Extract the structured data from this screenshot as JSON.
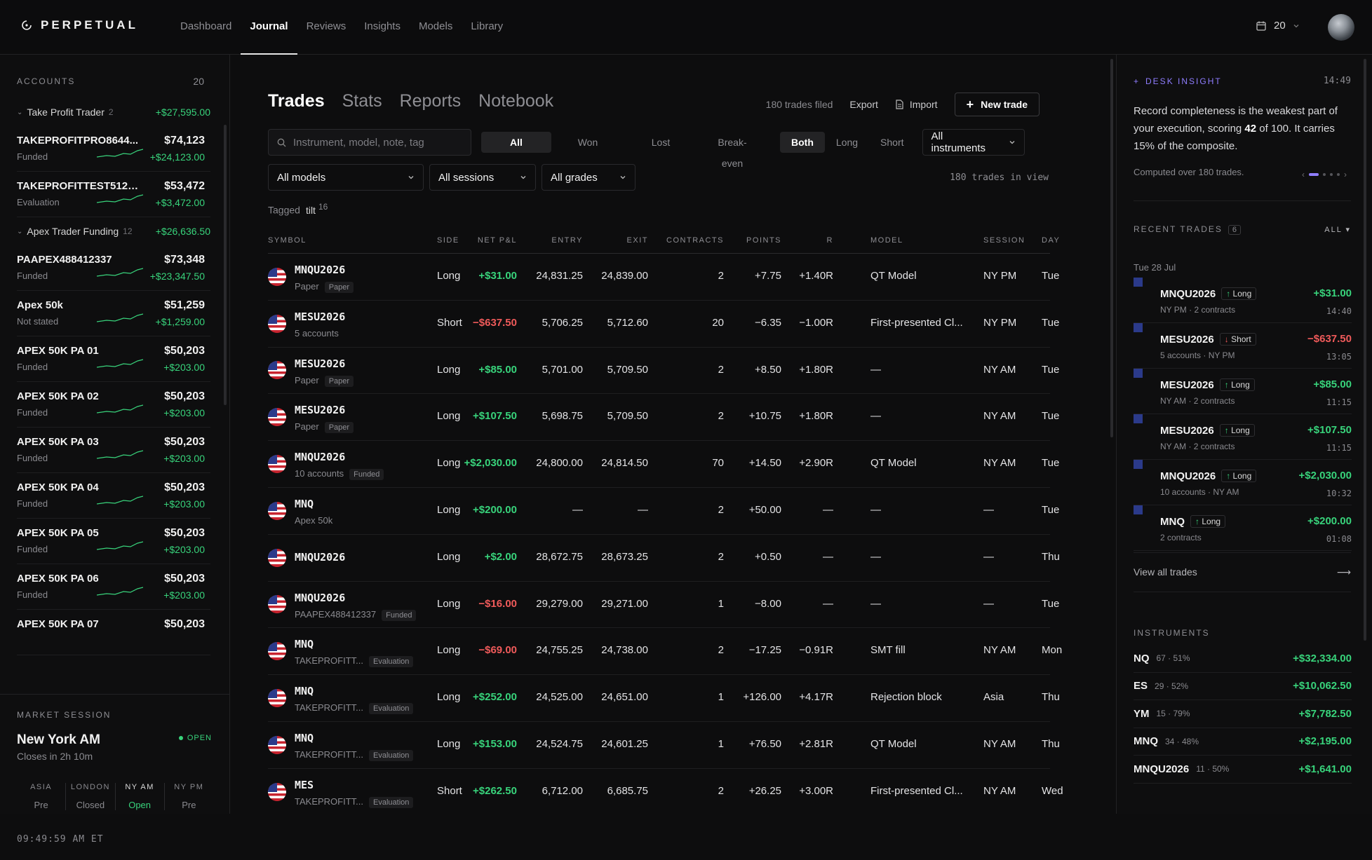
{
  "brand": {
    "name": "PERPETUAL"
  },
  "nav": [
    "Dashboard",
    "Journal",
    "Reviews",
    "Insights",
    "Models",
    "Library"
  ],
  "header": {
    "count": "20"
  },
  "accounts": {
    "label": "ACCOUNTS",
    "count": "20",
    "groups": [
      {
        "name": "Take Profit Trader",
        "count": "2",
        "pnl": "+$27,595.00"
      },
      {
        "name": "Apex Trader Funding",
        "count": "12",
        "pnl": "+$26,636.50"
      }
    ],
    "items": [
      {
        "name": "TAKEPROFITPRO8644...",
        "balance": "$74,123",
        "status": "Funded",
        "pnl": "+$24,123.00"
      },
      {
        "name": "TAKEPROFITTEST51290...",
        "balance": "$53,472",
        "status": "Evaluation",
        "pnl": "+$3,472.00"
      },
      {
        "name": "PAAPEX488412337",
        "balance": "$73,348",
        "status": "Funded",
        "pnl": "+$23,347.50"
      },
      {
        "name": "Apex 50k",
        "balance": "$51,259",
        "status": "Not stated",
        "pnl": "+$1,259.00"
      },
      {
        "name": "APEX 50K PA 01",
        "balance": "$50,203",
        "status": "Funded",
        "pnl": "+$203.00"
      },
      {
        "name": "APEX 50K PA 02",
        "balance": "$50,203",
        "status": "Funded",
        "pnl": "+$203.00"
      },
      {
        "name": "APEX 50K PA 03",
        "balance": "$50,203",
        "status": "Funded",
        "pnl": "+$203.00"
      },
      {
        "name": "APEX 50K PA 04",
        "balance": "$50,203",
        "status": "Funded",
        "pnl": "+$203.00"
      },
      {
        "name": "APEX 50K PA 05",
        "balance": "$50,203",
        "status": "Funded",
        "pnl": "+$203.00"
      },
      {
        "name": "APEX 50K PA 06",
        "balance": "$50,203",
        "status": "Funded",
        "pnl": "+$203.00"
      },
      {
        "name": "APEX 50K PA 07",
        "balance": "$50,203",
        "status": "",
        "pnl": ""
      }
    ]
  },
  "session": {
    "label": "MARKET SESSION",
    "name": "New York AM",
    "sub": "Closes in 2h 10m",
    "status": "OPEN",
    "cols": [
      {
        "k": "ASIA",
        "v": "Pre"
      },
      {
        "k": "LONDON",
        "v": "Closed"
      },
      {
        "k": "NY AM",
        "v": "Open"
      },
      {
        "k": "NY PM",
        "v": "Pre"
      }
    ],
    "clock": "09:49:59 AM ET"
  },
  "main": {
    "tabs": [
      "Trades",
      "Stats",
      "Reports",
      "Notebook"
    ],
    "filed": "180 trades filed",
    "export": "Export",
    "import": "Import",
    "new_trade": "New trade",
    "search_placeholder": "Instrument, model, note, tag",
    "outcome": [
      "All",
      "Won",
      "Lost",
      "Break-even"
    ],
    "direction": [
      "Both",
      "Long",
      "Short"
    ],
    "instruments": "All instruments",
    "models": "All models",
    "sessions": "All sessions",
    "grades": "All grades",
    "in_view": "180 trades in view",
    "tagged_label": "Tagged",
    "tag": "tilt",
    "tag_count": "16",
    "columns": [
      "SYMBOL",
      "SIDE",
      "NET P&L",
      "ENTRY",
      "EXIT",
      "CONTRACTS",
      "POINTS",
      "R",
      "MODEL",
      "SESSION",
      "DAY"
    ]
  },
  "trades": [
    {
      "symbol": "MNQU2026",
      "sub": "Paper",
      "badge": "Paper",
      "side": "Long",
      "pnl": "+$31.00",
      "entry": "24,831.25",
      "exit": "24,839.00",
      "contracts": "2",
      "points": "+7.75",
      "r": "+1.40R",
      "model": "QT Model",
      "session": "NY PM",
      "day": "Tue"
    },
    {
      "symbol": "MESU2026",
      "sub": "5 accounts",
      "badge": "",
      "side": "Short",
      "pnl": "−$637.50",
      "entry": "5,706.25",
      "exit": "5,712.60",
      "contracts": "20",
      "points": "−6.35",
      "r": "−1.00R",
      "model": "First-presented Cl...",
      "session": "NY PM",
      "day": "Tue"
    },
    {
      "symbol": "MESU2026",
      "sub": "Paper",
      "badge": "Paper",
      "side": "Long",
      "pnl": "+$85.00",
      "entry": "5,701.00",
      "exit": "5,709.50",
      "contracts": "2",
      "points": "+8.50",
      "r": "+1.80R",
      "model": "—",
      "session": "NY AM",
      "day": "Tue"
    },
    {
      "symbol": "MESU2026",
      "sub": "Paper",
      "badge": "Paper",
      "side": "Long",
      "pnl": "+$107.50",
      "entry": "5,698.75",
      "exit": "5,709.50",
      "contracts": "2",
      "points": "+10.75",
      "r": "+1.80R",
      "model": "—",
      "session": "NY AM",
      "day": "Tue"
    },
    {
      "symbol": "MNQU2026",
      "sub": "10 accounts",
      "badge": "Funded",
      "side": "Long",
      "pnl": "+$2,030.00",
      "entry": "24,800.00",
      "exit": "24,814.50",
      "contracts": "70",
      "points": "+14.50",
      "r": "+2.90R",
      "model": "QT Model",
      "session": "NY AM",
      "day": "Tue"
    },
    {
      "symbol": "MNQ",
      "sub": "Apex 50k",
      "badge": "",
      "side": "Long",
      "pnl": "+$200.00",
      "entry": "—",
      "exit": "—",
      "contracts": "2",
      "points": "+50.00",
      "r": "—",
      "model": "—",
      "session": "—",
      "day": "Tue"
    },
    {
      "symbol": "MNQU2026",
      "sub": "",
      "badge": "",
      "side": "Long",
      "pnl": "+$2.00",
      "entry": "28,672.75",
      "exit": "28,673.25",
      "contracts": "2",
      "points": "+0.50",
      "r": "—",
      "model": "—",
      "session": "—",
      "day": "Thu"
    },
    {
      "symbol": "MNQU2026",
      "sub": "PAAPEX488412337",
      "badge": "Funded",
      "side": "Long",
      "pnl": "−$16.00",
      "entry": "29,279.00",
      "exit": "29,271.00",
      "contracts": "1",
      "points": "−8.00",
      "r": "—",
      "model": "—",
      "session": "—",
      "day": "Tue"
    },
    {
      "symbol": "MNQ",
      "sub": "TAKEPROFITT...",
      "badge": "Evaluation",
      "side": "Long",
      "pnl": "−$69.00",
      "entry": "24,755.25",
      "exit": "24,738.00",
      "contracts": "2",
      "points": "−17.25",
      "r": "−0.91R",
      "model": "SMT fill",
      "session": "NY AM",
      "day": "Mon"
    },
    {
      "symbol": "MNQ",
      "sub": "TAKEPROFITT...",
      "badge": "Evaluation",
      "side": "Long",
      "pnl": "+$252.00",
      "entry": "24,525.00",
      "exit": "24,651.00",
      "contracts": "1",
      "points": "+126.00",
      "r": "+4.17R",
      "model": "Rejection block",
      "session": "Asia",
      "day": "Thu"
    },
    {
      "symbol": "MNQ",
      "sub": "TAKEPROFITT...",
      "badge": "Evaluation",
      "side": "Long",
      "pnl": "+$153.00",
      "entry": "24,524.75",
      "exit": "24,601.25",
      "contracts": "1",
      "points": "+76.50",
      "r": "+2.81R",
      "model": "QT Model",
      "session": "NY AM",
      "day": "Thu"
    },
    {
      "symbol": "MES",
      "sub": "TAKEPROFITT...",
      "badge": "Evaluation",
      "side": "Short",
      "pnl": "+$262.50",
      "entry": "6,712.00",
      "exit": "6,685.75",
      "contracts": "2",
      "points": "+26.25",
      "r": "+3.00R",
      "model": "First-presented Cl...",
      "session": "NY AM",
      "day": "Wed"
    }
  ],
  "insight": {
    "label": "DESK INSIGHT",
    "time": "14:49",
    "text_a": "Record completeness is the weakest part of your execution, scoring ",
    "score": "42",
    "text_b": " of 100. It carries 15% of the composite.",
    "computed": "Computed over 180 trades.",
    "carousel_active": 1,
    "carousel_total": 4
  },
  "recent": {
    "label": "RECENT TRADES",
    "count": "6",
    "filter": "ALL",
    "date": "Tue 28 Jul",
    "items": [
      {
        "symbol": "MNQU2026",
        "side": "Long",
        "desc": "NY PM · 2 contracts",
        "pnl": "+$31.00",
        "time": "14:40"
      },
      {
        "symbol": "MESU2026",
        "side": "Short",
        "desc": "5 accounts · NY PM",
        "pnl": "−$637.50",
        "time": "13:05"
      },
      {
        "symbol": "MESU2026",
        "side": "Long",
        "desc": "NY AM · 2 contracts",
        "pnl": "+$85.00",
        "time": "11:15"
      },
      {
        "symbol": "MESU2026",
        "side": "Long",
        "desc": "NY AM · 2 contracts",
        "pnl": "+$107.50",
        "time": "11:15"
      },
      {
        "symbol": "MNQU2026",
        "side": "Long",
        "desc": "10 accounts · NY AM",
        "pnl": "+$2,030.00",
        "time": "10:32"
      },
      {
        "symbol": "MNQ",
        "side": "Long",
        "desc": "2 contracts",
        "pnl": "+$200.00",
        "time": "01:08"
      }
    ],
    "view_all": "View all trades"
  },
  "instruments": {
    "label": "INSTRUMENTS",
    "items": [
      {
        "symbol": "NQ",
        "meta": "67 · 51%",
        "pnl": "+$32,334.00"
      },
      {
        "symbol": "ES",
        "meta": "29 · 52%",
        "pnl": "+$10,062.50"
      },
      {
        "symbol": "YM",
        "meta": "15 · 79%",
        "pnl": "+$7,782.50"
      },
      {
        "symbol": "MNQ",
        "meta": "34 · 48%",
        "pnl": "+$2,195.00"
      },
      {
        "symbol": "MNQU2026",
        "meta": "11 · 50%",
        "pnl": "+$1,641.00"
      }
    ]
  }
}
